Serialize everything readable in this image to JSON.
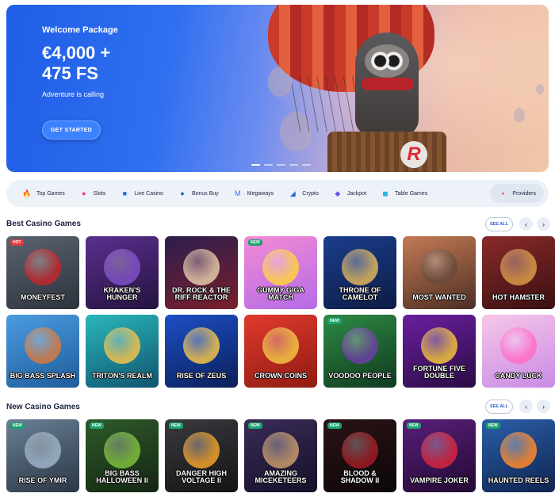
{
  "hero": {
    "title": "Welcome Package",
    "amount_line1": "€4,000 +",
    "amount_line2": "475 FS",
    "tagline": "Adventure is calling",
    "cta": "GET STARTED",
    "logo_letter": "R"
  },
  "categories": [
    {
      "label": "Top Games",
      "icon": "flame-icon",
      "color": "#ff6a2b"
    },
    {
      "label": "Slots",
      "icon": "cherries-icon",
      "color": "#ff2f6b"
    },
    {
      "label": "Live Casino",
      "icon": "live-casino-icon",
      "color": "#2a6de0"
    },
    {
      "label": "Bonus Buy",
      "icon": "bonus-bag-icon",
      "color": "#1e5fd8"
    },
    {
      "label": "Megaways",
      "icon": "megaways-icon",
      "color": "#3a6cf0"
    },
    {
      "label": "Crypto",
      "icon": "crypto-icon",
      "color": "#2b62d9"
    },
    {
      "label": "Jackpot",
      "icon": "diamond-icon",
      "color": "#6a4cf5"
    },
    {
      "label": "Table Games",
      "icon": "table-games-icon",
      "color": "#26b6e0"
    },
    {
      "label": "Providers",
      "icon": "providers-icon",
      "color": "#e93b5a"
    }
  ],
  "best": {
    "title": "Best Casino Games",
    "see_all": "SEE ALL",
    "prev": "‹",
    "next": "›",
    "games": [
      {
        "name": "Moneyfest",
        "badge": "HOT",
        "bg": "linear-gradient(160deg,#5a6370,#2d333c)",
        "art": "#c2262b"
      },
      {
        "name": "Kraken's Hunger",
        "badge": "",
        "bg": "linear-gradient(160deg,#5a2f8e,#24133e)",
        "art": "#7e4fc9"
      },
      {
        "name": "Dr. Rock & The Riff Reactor",
        "badge": "",
        "bg": "linear-gradient(160deg,#2c1d4e,#7a1f2b)",
        "art": "#e4c9a8"
      },
      {
        "name": "Gummy Giga Match",
        "badge": "NEW",
        "bg": "linear-gradient(160deg,#f38ad3,#b56be8)",
        "art": "#ffd23f"
      },
      {
        "name": "Throne of Camelot",
        "badge": "",
        "bg": "linear-gradient(160deg,#1b3d8c,#0c1c45)",
        "art": "#e0b55a"
      },
      {
        "name": "Most Wanted",
        "badge": "",
        "bg": "linear-gradient(160deg,#c47b55,#4d2d24)",
        "art": "#6b4a3a"
      },
      {
        "name": "Hot Hamster",
        "badge": "",
        "bg": "linear-gradient(160deg,#8a2a2a,#3a1010)",
        "art": "#d99a4a"
      },
      {
        "name": "Big Bass Splash",
        "badge": "",
        "bg": "linear-gradient(160deg,#4b9be0,#1f5d9b)",
        "art": "#d67a3e"
      },
      {
        "name": "Triton's Realm",
        "badge": "",
        "bg": "linear-gradient(160deg,#2bb7b9,#0f5470)",
        "art": "#f0c24b"
      },
      {
        "name": "Rise of Zeus",
        "badge": "",
        "bg": "linear-gradient(160deg,#1c4fc4,#0b1f5a)",
        "art": "#f2c44a"
      },
      {
        "name": "Crown Coins",
        "badge": "",
        "bg": "linear-gradient(160deg,#e03a2c,#8f1b12)",
        "art": "#f4c542"
      },
      {
        "name": "Voodoo People",
        "badge": "NEW",
        "bg": "linear-gradient(160deg,#2e8a45,#0f3a1f)",
        "art": "#6b3fa3"
      },
      {
        "name": "Fortune Five Double",
        "badge": "",
        "bg": "linear-gradient(160deg,#6a1f9e,#2a0b45)",
        "art": "#f0c13c"
      },
      {
        "name": "Candy Luck",
        "badge": "",
        "bg": "linear-gradient(160deg,#f7c6e8,#c98be6)",
        "art": "#ff6ec7"
      }
    ]
  },
  "new": {
    "title": "New Casino Games",
    "see_all": "SEE ALL",
    "prev": "‹",
    "next": "›",
    "games": [
      {
        "name": "Rise of Ymir",
        "badge": "NEW",
        "bg": "linear-gradient(160deg,#6a7f96,#2b3744)",
        "art": "#9db3c9"
      },
      {
        "name": "Big Bass Halloween II",
        "badge": "NEW",
        "bg": "linear-gradient(160deg,#2f5a2a,#132611)",
        "art": "#7fbf3f"
      },
      {
        "name": "Danger High Voltage II",
        "badge": "NEW",
        "bg": "linear-gradient(160deg,#3a3a3f,#141416)",
        "art": "#f0a12a"
      },
      {
        "name": "Amazing Miceketeers",
        "badge": "NEW",
        "bg": "linear-gradient(160deg,#3a2b57,#16102a)",
        "art": "#c89a6a"
      },
      {
        "name": "Blood & Shadow II",
        "badge": "NEW",
        "bg": "linear-gradient(160deg,#2a1416,#0c0607)",
        "art": "#a11b24"
      },
      {
        "name": "Vampire Joker",
        "badge": "NEW",
        "bg": "linear-gradient(160deg,#5a1e7a,#220a33)",
        "art": "#d7263d"
      },
      {
        "name": "Haunted Reels",
        "badge": "NEW",
        "bg": "linear-gradient(160deg,#2a5fa8,#0f2450)",
        "art": "#ff8a2b"
      }
    ]
  }
}
